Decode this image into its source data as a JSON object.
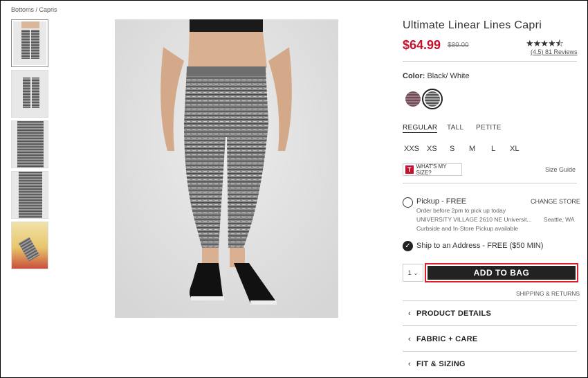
{
  "breadcrumb": "Bottoms / Capris",
  "product": {
    "title": "Ultimate Linear Lines Capri",
    "price": "$64.99",
    "old_price": "$89.00",
    "rating_value": 4.5,
    "stars": "★★★★⯪",
    "reviews": "(4.5) 81 Reviews"
  },
  "color": {
    "label": "Color:",
    "value": "Black/ White",
    "swatches": [
      "heather-purple",
      "black-white"
    ],
    "selected": "black-white"
  },
  "fit_tabs": [
    "REGULAR",
    "TALL",
    "PETITE"
  ],
  "sizes": [
    "XXS",
    "XS",
    "S",
    "M",
    "L",
    "XL"
  ],
  "whats_my_size": "WHAT'S MY SIZE?",
  "size_guide": "Size Guide",
  "pickup": {
    "label": "Pickup - FREE",
    "change_store": "CHANGE STORE",
    "line1": "Order before 2pm to pick up today",
    "line2": "UNIVERSITY VILLAGE 2610 NE Universit...",
    "city": "Seattle, WA",
    "line3": "Curbside and In-Store Pickup available"
  },
  "ship": {
    "label": "Ship to an Address - FREE ($50 MIN)"
  },
  "quantity": "1",
  "add_to_bag": "ADD TO BAG",
  "shipping_returns": "SHIPPING & RETURNS",
  "accordions": [
    "PRODUCT DETAILS",
    "FABRIC + CARE",
    "FIT & SIZING"
  ],
  "colors": {
    "price_red": "#c4122f",
    "button_dark": "#222222",
    "highlight": "#e01e2e"
  }
}
